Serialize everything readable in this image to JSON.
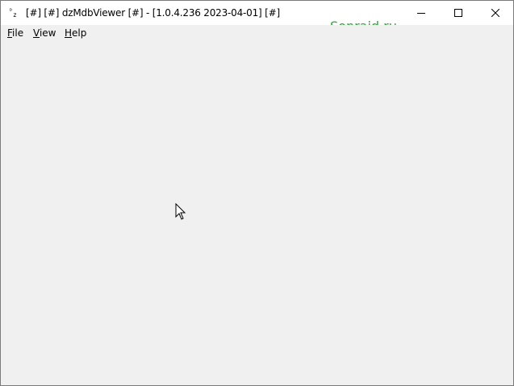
{
  "window": {
    "title": "[#] [#] dzMdbViewer [#] - [1.0.4.236 2023-04-01] [#]",
    "icon": "dz-app-icon"
  },
  "watermark": "Sonraid.ru",
  "caption_buttons": [
    "minimize",
    "maximize",
    "close"
  ],
  "menu": {
    "file": {
      "accel": "F",
      "rest": "ile"
    },
    "view": {
      "accel": "V",
      "rest": "iew"
    },
    "help": {
      "accel": "H",
      "rest": "elp"
    }
  },
  "colors": {
    "watermark": "#2eaa3a",
    "background": "#f0f0f0",
    "titlebar": "#ffffff"
  }
}
